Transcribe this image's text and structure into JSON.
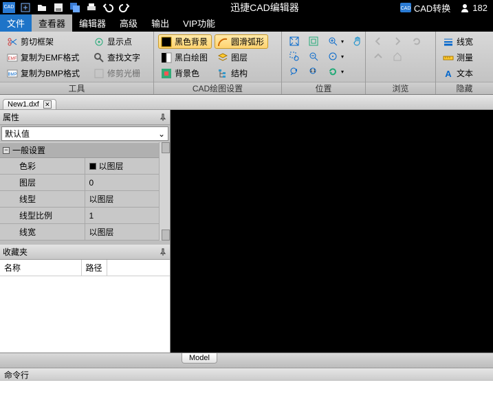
{
  "app": {
    "title": "迅捷CAD编辑器"
  },
  "titlebar_right": {
    "convert": "CAD转换",
    "user": "182"
  },
  "menu": {
    "file": "文件",
    "viewer": "查看器",
    "editor": "编辑器",
    "advanced": "高级",
    "output": "输出",
    "vip": "VIP功能"
  },
  "ribbon": {
    "tools": {
      "label": "工具",
      "clip": "剪切框架",
      "emf": "复制为EMF格式",
      "bmp": "复制为BMP格式",
      "showpt": "显示点",
      "findtext": "查找文字",
      "trimraster": "修剪光栅"
    },
    "cad": {
      "label": "CAD绘图设置",
      "blackbg": "黑色背景",
      "bwdraw": "黑白绘图",
      "bgcolor": "背景色",
      "smootharc": "圆滑弧形",
      "layers": "图层",
      "struct": "结构"
    },
    "position": {
      "label": "位置"
    },
    "browse": {
      "label": "浏览"
    },
    "hide": {
      "label": "隐藏",
      "lw": "线宽",
      "measure": "测量",
      "text": "文本"
    }
  },
  "doc": {
    "tab": "New1.dxf"
  },
  "props": {
    "title": "属性",
    "default": "默认值",
    "group": "一般设置",
    "rows": {
      "color": {
        "k": "色彩",
        "v": "以图层"
      },
      "layer": {
        "k": "图层",
        "v": "0"
      },
      "ltype": {
        "k": "线型",
        "v": "以图层"
      },
      "ltscale": {
        "k": "线型比例",
        "v": "1"
      },
      "lweight": {
        "k": "线宽",
        "v": "以图层"
      }
    }
  },
  "fav": {
    "title": "收藏夹",
    "col_name": "名称",
    "col_path": "路径"
  },
  "model": {
    "tab": "Model"
  },
  "cmd": {
    "label": "命令行"
  }
}
